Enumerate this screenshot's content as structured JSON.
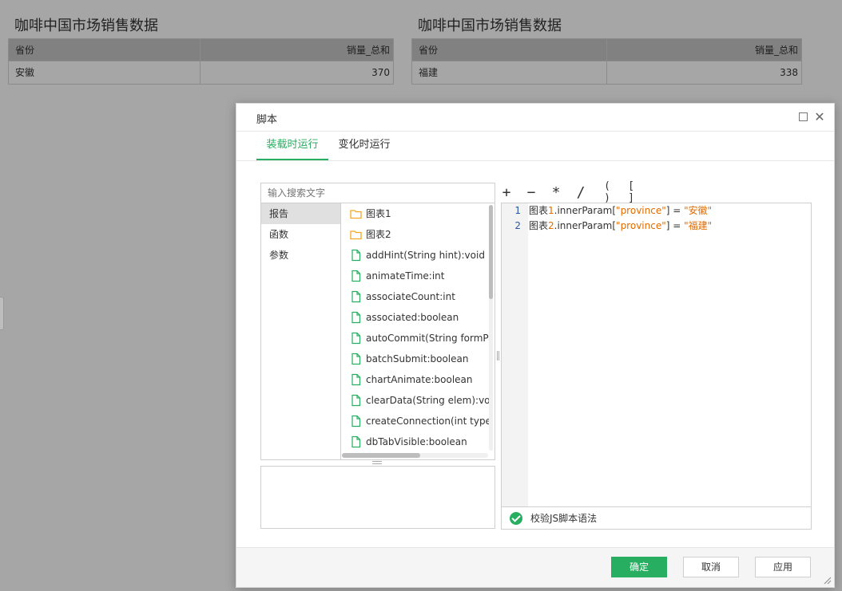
{
  "report": {
    "tables": [
      {
        "title": "咖啡中国市场销售数据",
        "col1": "省份",
        "col2": "销量_总和",
        "row": {
          "province": "安徽",
          "value": "370"
        }
      },
      {
        "title": "咖啡中国市场销售数据",
        "col1": "省份",
        "col2": "销量_总和",
        "row": {
          "province": "福建",
          "value": "338"
        }
      }
    ]
  },
  "dialog": {
    "title": "脚本",
    "tabs": [
      "装载时运行",
      "变化时运行"
    ],
    "search_placeholder": "输入搜索文字",
    "categories": [
      "报告",
      "函数",
      "参数"
    ],
    "items": [
      "图表1",
      "图表2",
      "addHint(String hint):void",
      "animateTime:int",
      "associateCount:int",
      "associated:boolean",
      "autoCommit(String formParm",
      "batchSubmit:boolean",
      "chartAnimate:boolean",
      "clearData(String elem):void",
      "createConnection(int type,Str",
      "dbTabVisible:boolean"
    ],
    "operators": [
      "+",
      "−",
      "*",
      "/",
      "( )",
      "[ ]"
    ],
    "code": [
      {
        "ln": "1",
        "a": "图表",
        "n": "1",
        "b": ".innerParam[",
        "s1": "\"province\"",
        "c": "] = ",
        "s2": "\"安徽\""
      },
      {
        "ln": "2",
        "a": "图表",
        "n": "2",
        "b": ".innerParam[",
        "s1": "\"province\"",
        "c": "] = ",
        "s2": "\"福建\""
      }
    ],
    "status": "校验JS脚本语法",
    "buttons": {
      "ok": "确定",
      "cancel": "取消",
      "apply": "应用"
    }
  },
  "colors": {
    "accent": "#27ae60",
    "folder": "#f5a623",
    "file": "#27ae60",
    "string": "#e06c00"
  }
}
